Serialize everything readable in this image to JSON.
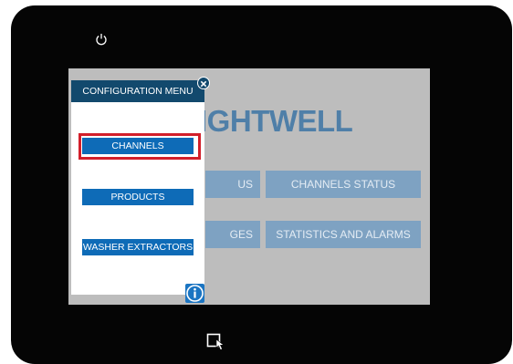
{
  "brand": {
    "visible_text": "IGHTWELL"
  },
  "dashboard": {
    "tiles": [
      {
        "label": "US"
      },
      {
        "label": "CHANNELS STATUS"
      },
      {
        "label": "GES"
      },
      {
        "label": "STATISTICS AND ALARMS"
      }
    ]
  },
  "config_menu": {
    "title": "CONFIGURATION MENU",
    "items": [
      {
        "label": "CHANNELS",
        "selected": true
      },
      {
        "label": "PRODUCTS"
      },
      {
        "label": "WASHER EXTRACTORS"
      }
    ]
  },
  "icons": {
    "power": "power-icon",
    "close": "close-icon",
    "info": "info-icon",
    "hand": "hand-pointer-icon"
  },
  "colors": {
    "menu_header": "#12496d",
    "menu_button": "#0e6bb7",
    "highlight": "#d21f2a",
    "screen_bg": "#bdbdbd",
    "brand": "#4f7fa8",
    "tile": "#7ea2c2"
  }
}
